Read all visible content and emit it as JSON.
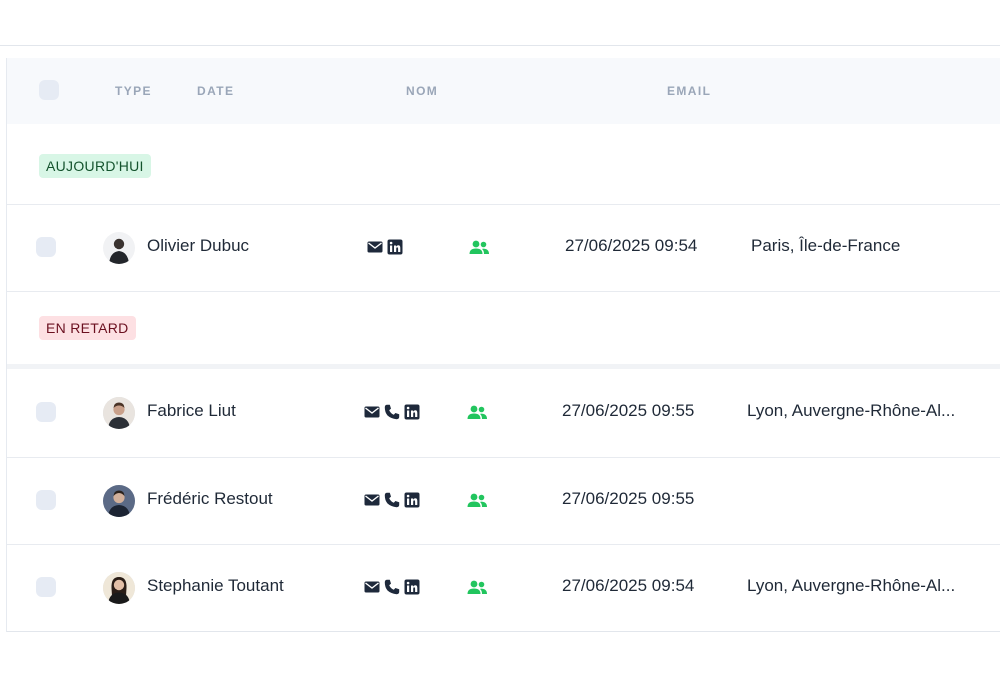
{
  "header": {
    "columns": [
      "TYPE",
      "DATE",
      "NOM",
      "EMAIL"
    ]
  },
  "sections": [
    {
      "badge": "AUJOURD'HUI",
      "badge_color": "#d8f6e6",
      "rows": [
        {
          "name": "Olivier Dubuc",
          "contacts": [
            "mail-icon",
            "linkedin-icon"
          ],
          "type_icon": "users-icon",
          "datetime": "27/06/2025 09:54",
          "location": "Paris, Île-de-France",
          "avatar_icon": "avatar-photo-icon"
        }
      ]
    },
    {
      "badge": "EN RETARD",
      "badge_color": "#fde0e3",
      "rows": [
        {
          "name": "Fabrice Liut",
          "contacts": [
            "mail-icon",
            "phone-icon",
            "linkedin-icon"
          ],
          "type_icon": "users-icon",
          "datetime": "27/06/2025 09:55",
          "location": "Lyon, Auvergne-Rhône-Al...",
          "avatar_icon": "avatar-photo-icon"
        },
        {
          "name": "Frédéric Restout",
          "contacts": [
            "mail-icon",
            "phone-icon",
            "linkedin-icon"
          ],
          "type_icon": "users-icon",
          "datetime": "27/06/2025 09:55",
          "location": "",
          "avatar_icon": "avatar-photo-icon"
        },
        {
          "name": "Stephanie Toutant",
          "contacts": [
            "mail-icon",
            "phone-icon",
            "linkedin-icon"
          ],
          "type_icon": "users-icon",
          "datetime": "27/06/2025 09:54",
          "location": "Lyon, Auvergne-Rhône-Al...",
          "avatar_icon": "avatar-photo-icon"
        }
      ]
    }
  ],
  "colors": {
    "accent_green": "#22c55e",
    "icon_dark": "#1e293b",
    "header_bg": "#f7f9fc"
  }
}
